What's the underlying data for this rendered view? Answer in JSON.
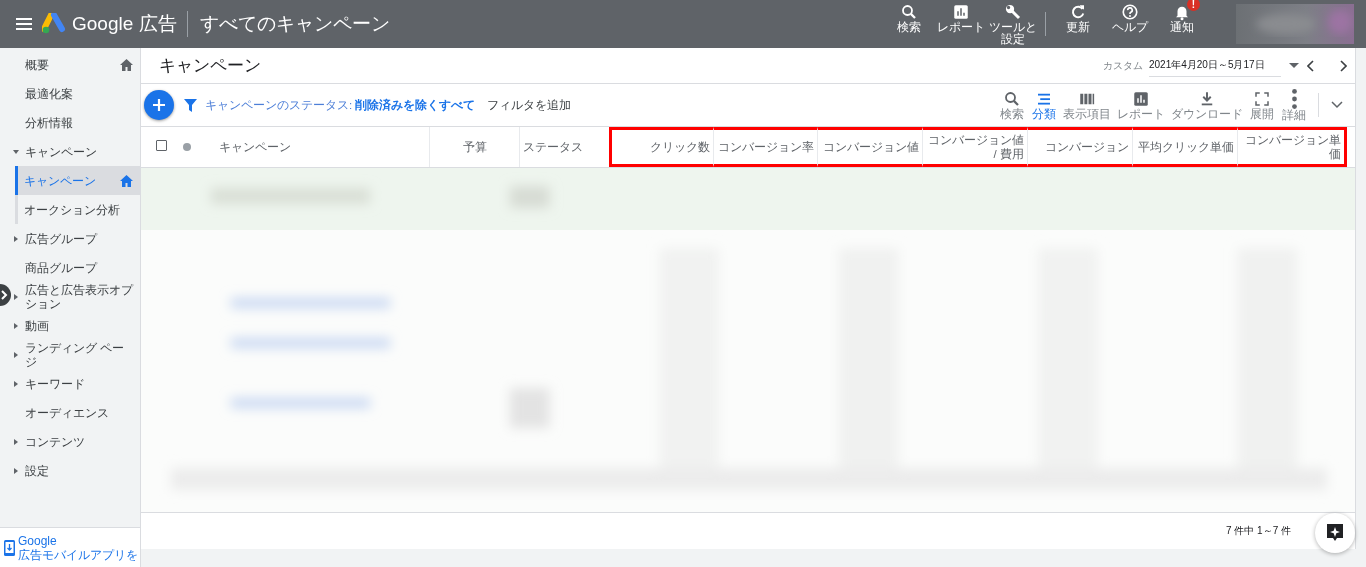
{
  "header": {
    "app_name": "Google 広告",
    "page_title": "すべてのキャンペーン",
    "actions": [
      {
        "kind": "search",
        "label": "検索"
      },
      {
        "kind": "report",
        "label": "レポート"
      },
      {
        "kind": "tools",
        "label": "ツールと設定"
      },
      {
        "kind": "refresh",
        "label": "更新"
      },
      {
        "kind": "help",
        "label": "ヘルプ"
      },
      {
        "kind": "notifications",
        "label": "通知",
        "badge": "!"
      }
    ]
  },
  "sidebar": {
    "items": [
      {
        "kind": "item",
        "label": "概要",
        "home": true,
        "selected": false
      },
      {
        "kind": "item",
        "label": "最適化案",
        "home": false,
        "selected": false
      },
      {
        "kind": "item",
        "label": "分析情報",
        "home": false,
        "selected": false
      },
      {
        "kind": "group",
        "label": "キャンペーン",
        "home": false,
        "selected": false,
        "expanded": true,
        "children": [
          {
            "kind": "item",
            "label": "キャンペーン",
            "home": true,
            "selected": true
          },
          {
            "kind": "item",
            "label": "オークション分析",
            "home": false,
            "selected": false
          }
        ]
      },
      {
        "kind": "group",
        "label": "広告グループ",
        "home": false,
        "selected": false,
        "expanded": false
      },
      {
        "kind": "item",
        "label": "商品グループ",
        "home": false,
        "selected": false
      },
      {
        "kind": "group",
        "label": "広告と広告表示オプション",
        "home": false,
        "selected": false,
        "expanded": false
      },
      {
        "kind": "group",
        "label": "動画",
        "home": false,
        "selected": false,
        "expanded": false
      },
      {
        "kind": "group",
        "label": "ランディング ページ",
        "home": false,
        "selected": false,
        "expanded": false
      },
      {
        "kind": "group",
        "label": "キーワード",
        "home": false,
        "selected": false,
        "expanded": false
      },
      {
        "kind": "item",
        "label": "オーディエンス",
        "home": false,
        "selected": false
      },
      {
        "kind": "group",
        "label": "コンテンツ",
        "home": false,
        "selected": false,
        "expanded": false
      },
      {
        "kind": "group",
        "label": "設定",
        "home": false,
        "selected": false,
        "expanded": false
      }
    ],
    "app_link": {
      "line_1": "Google",
      "line_2": "広告モバイルアプリを"
    }
  },
  "main": {
    "title": "キャンペーン",
    "date_range": {
      "label": "カスタム",
      "value": "2021年4月20日～5月17日"
    },
    "filter": {
      "text": "キャンペーンのステータス: **削除済みを除くすべて**",
      "add": "フィルタを追加"
    },
    "tools": [
      {
        "kind": "search",
        "label": "検索",
        "selected": false
      },
      {
        "kind": "segment",
        "label": "分類",
        "selected": true
      },
      {
        "kind": "columns",
        "label": "表示項目",
        "selected": false
      },
      {
        "kind": "report",
        "label": "レポート",
        "selected": false
      },
      {
        "kind": "download",
        "label": "ダウンロード",
        "selected": false
      },
      {
        "kind": "expand",
        "label": "展開",
        "selected": false
      },
      {
        "kind": "more",
        "label": "詳細",
        "selected": false
      }
    ]
  },
  "table": {
    "select_all": {
      "checked": false
    },
    "columns": [
      {
        "label": "キャンペーン",
        "highlighted": false
      },
      {
        "label": "予算",
        "highlighted": false
      },
      {
        "label": "ステータス",
        "highlighted": false
      },
      {
        "label": "クリック数",
        "highlighted": true
      },
      {
        "label": "コンバージョン率",
        "highlighted": true
      },
      {
        "label": "コンバージョン値",
        "highlighted": true
      },
      {
        "label": "コンバージョン値 / 費用",
        "highlighted": true
      },
      {
        "label": "コンバージョン",
        "highlighted": true
      },
      {
        "label": "平均クリック単価",
        "highlighted": true
      },
      {
        "label": "コンバージョン単価",
        "highlighted": true
      }
    ],
    "footer": "7 件中 1～7 件"
  }
}
